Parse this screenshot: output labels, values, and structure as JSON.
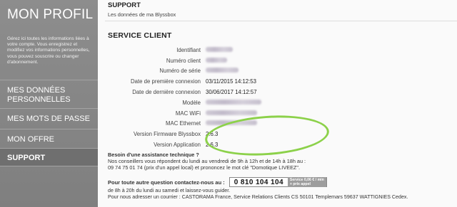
{
  "sidebar": {
    "title": "MON PROFIL",
    "description": "Gérez ici toutes les informations liées à votre compte. Vous enregistrez et modifiez vos informations personnelles, vous pouvez souscrire ou changer d'abonnement.",
    "items": [
      {
        "label": "MES DONNÉES PERSONNELLES",
        "active": false
      },
      {
        "label": "MES MOTS DE PASSE",
        "active": false
      },
      {
        "label": "MON OFFRE",
        "active": false
      },
      {
        "label": "SUPPORT",
        "active": true
      }
    ]
  },
  "main": {
    "header": "SUPPORT",
    "subheader": "Les données de ma Blyssbox",
    "section_title": "SERVICE CLIENT",
    "rows": [
      {
        "label": "Identifiant",
        "value": ""
      },
      {
        "label": "Numéro client",
        "value": ""
      },
      {
        "label": "Numéro de série",
        "value": ""
      },
      {
        "label": "Date de première connexion",
        "value": "03/11/2015 14:12:53"
      },
      {
        "label": "Date de dernière connexion",
        "value": "30/06/2017 14:12:57"
      },
      {
        "label": "Modèle",
        "value": ""
      },
      {
        "label": "MAC WiFi",
        "value": ""
      },
      {
        "label": "MAC Ethernet",
        "value": ""
      },
      {
        "label": "Version Firmware Blyssbox",
        "value": "2.6.3"
      },
      {
        "label": "Version Application",
        "value": "2.6.3"
      }
    ],
    "help": {
      "title": "Besoin d'une assistance technique ?",
      "line1": "Nos conseillers vous répondent du lundi au vendredi de 9h à 12h et de 14h à 18h au :",
      "line2": "09 74 75 01 74 (prix d'un appel local) et prononcez le mot clé \"Domotique LIVEEZ\".",
      "phone_prompt": "Pour toute autre question contactez-nous au :",
      "phone_number": "0 810 104 104",
      "phone_price_line1": "Service 0,06 € / min",
      "phone_price_line2": "+ prix appel",
      "hours": "de 8h à 20h du lundi au samedi et laissez-vous guider.",
      "mail": "Pour nous adresser un courrier : CASTORAMA France, Service Relations Clients CS 50101 Templemars 59637 WATTIGNIES Cedex."
    }
  }
}
